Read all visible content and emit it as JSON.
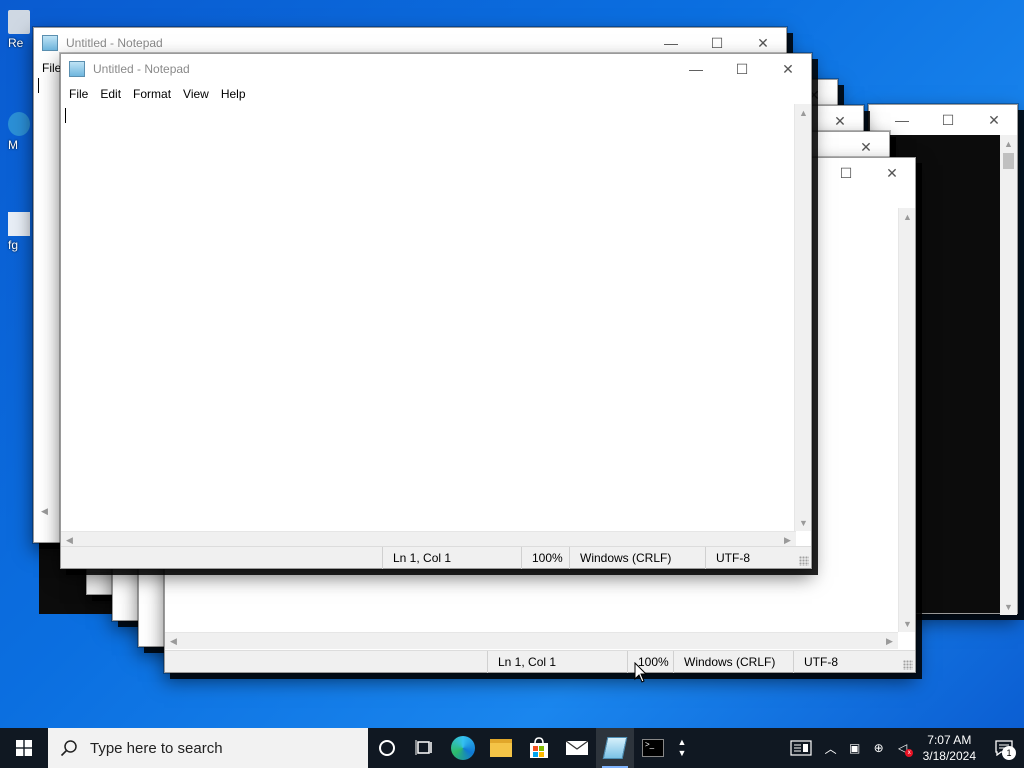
{
  "desktop": {
    "icons": [
      {
        "label": "Re"
      },
      {
        "label": "M"
      },
      {
        "label": "fg"
      }
    ]
  },
  "notepad": {
    "title": "Untitled - Notepad",
    "menu": [
      "File",
      "Edit",
      "Format",
      "View",
      "Help"
    ],
    "menu_first_partial": "File",
    "status": {
      "position": "Ln 1, Col 1",
      "zoom": "100%",
      "line_ending": "Windows (CRLF)",
      "encoding": "UTF-8"
    },
    "buttons": {
      "minimize": "—",
      "maximize": "☐",
      "close": "✕"
    }
  },
  "taskbar": {
    "search_placeholder": "Type here to search",
    "apps": [
      {
        "name": "cortana-icon"
      },
      {
        "name": "task-view-icon"
      },
      {
        "name": "edge-icon"
      },
      {
        "name": "file-explorer-icon"
      },
      {
        "name": "store-icon"
      },
      {
        "name": "mail-icon"
      },
      {
        "name": "notepad-icon",
        "active": true
      },
      {
        "name": "terminal-icon"
      }
    ],
    "clock_time": "7:07 AM",
    "clock_date": "3/18/2024",
    "notification_count": "1"
  }
}
